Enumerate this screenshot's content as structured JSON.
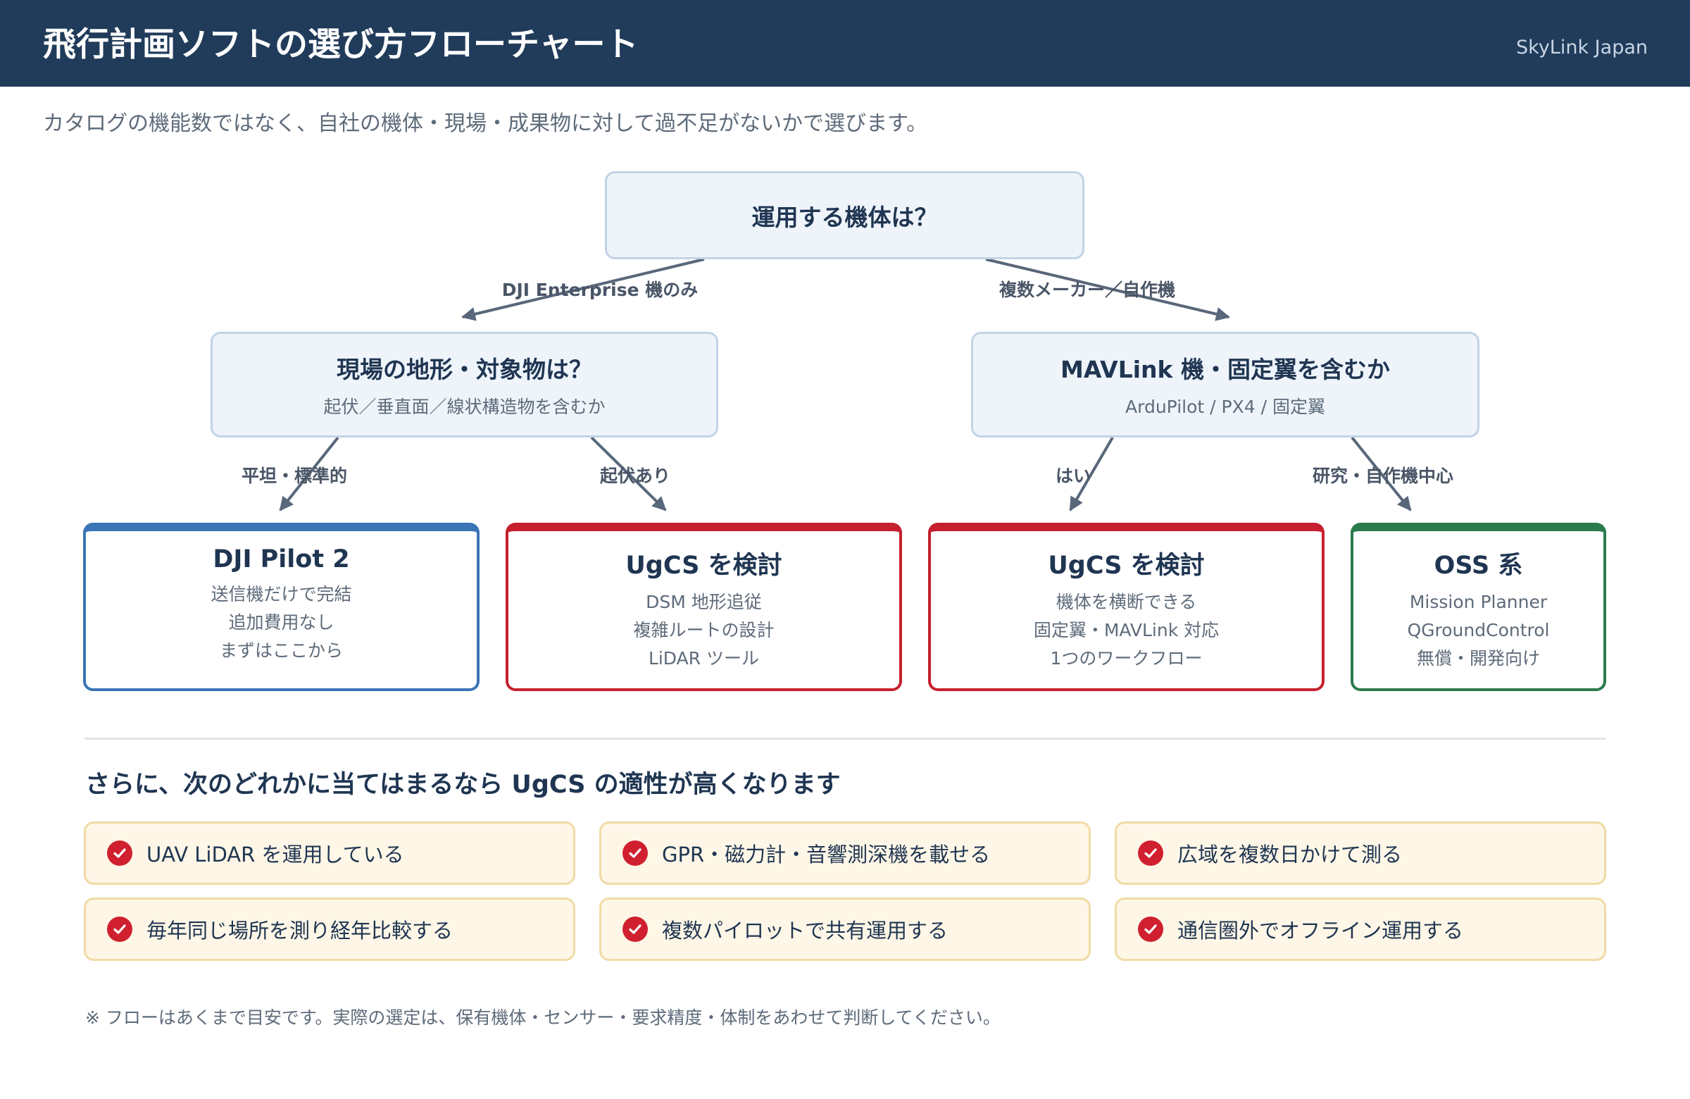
{
  "header": {
    "title": "飛行計画ソフトの選び方フローチャート",
    "brand": "SkyLink Japan"
  },
  "subtitle": "カタログの機能数ではなく、自社の機体・現場・成果物に対して過不足がないかで選びます。",
  "flow": {
    "root": {
      "title": "運用する機体は？"
    },
    "left_question": {
      "title": "現場の地形・対象物は？",
      "subtitle": "起伏／垂直面／線状構造物を含むか"
    },
    "right_question": {
      "title": "MAVLink 機・固定翼を含むか",
      "subtitle": "ArduPilot / PX4 / 固定翼"
    },
    "edges": {
      "root_left": "DJI Enterprise 機のみ",
      "root_right": "複数メーカー／自作機",
      "left_flat": "平坦・標準的",
      "left_relief": "起伏あり",
      "right_yes": "はい",
      "right_research": "研究・自作機中心"
    },
    "results": [
      {
        "title": "DJI Pilot 2",
        "lines": [
          "送信機だけで完結",
          "追加費用なし",
          "まずはここから"
        ],
        "accent": "#3a75b5"
      },
      {
        "title": "UgCS を検討",
        "lines": [
          "DSM 地形追従",
          "複雑ルートの設計",
          "LiDAR ツール"
        ],
        "accent": "#c6202e"
      },
      {
        "title": "UgCS を検討",
        "lines": [
          "機体を横断できる",
          "固定翼・MAVLink 対応",
          "1つのワークフロー"
        ],
        "accent": "#c6202e"
      },
      {
        "title": "OSS 系",
        "lines": [
          "Mission Planner",
          "QGroundControl",
          "無償・開発向け"
        ],
        "accent": "#2b7a4d"
      }
    ]
  },
  "conditions": {
    "title": "さらに、次のどれかに当てはまるなら UgCS の適性が高くなります",
    "items": [
      "UAV LiDAR を運用している",
      "GPR・磁力計・音響測深機を載せる",
      "広域を複数日かけて測る",
      "毎年同じ場所を測り経年比較する",
      "複数パイロットで共有運用する",
      "通信圏外でオフライン運用する"
    ],
    "check_color": "#d0202f"
  },
  "footnote": "※ フローはあくまで目安です。実際の選定は、保有機体・センサー・要求精度・体制をあわせて判断してください。"
}
